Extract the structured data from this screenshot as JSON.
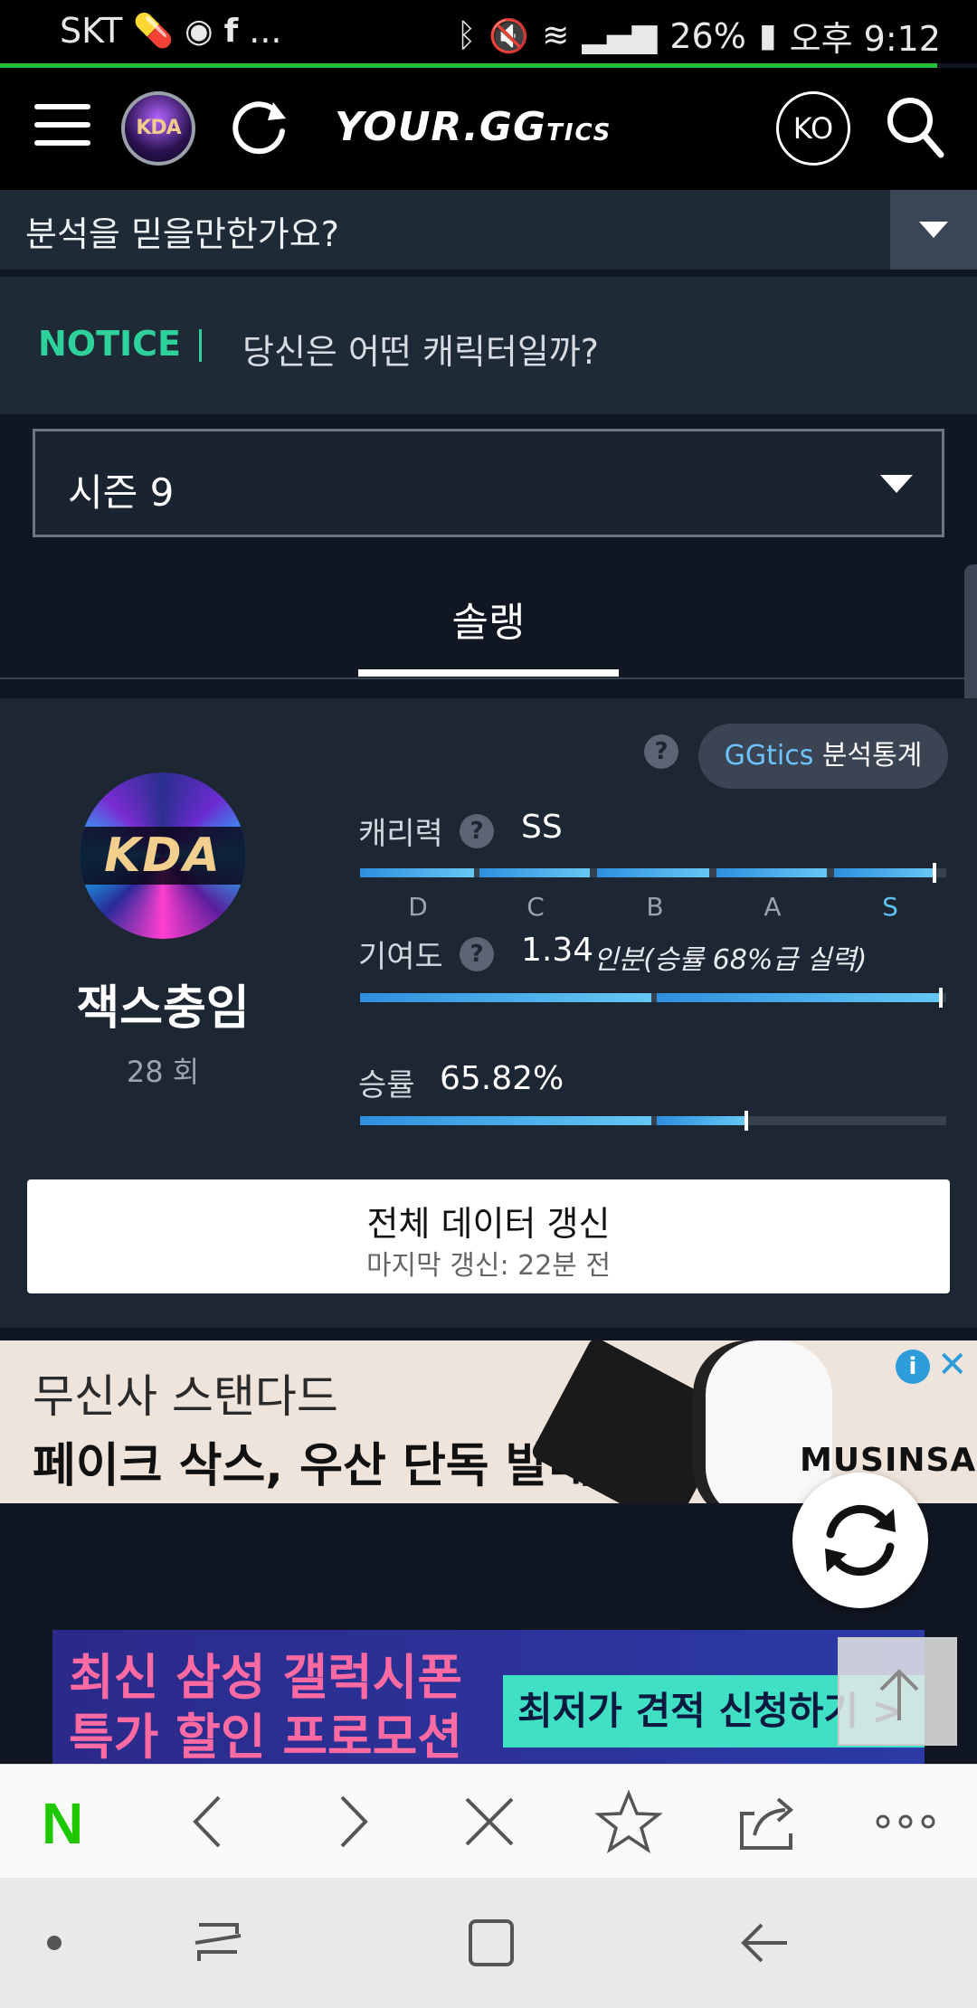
{
  "status_bar": {
    "carrier": "SKT",
    "more": "...",
    "battery": "26%",
    "time": "오후 9:12"
  },
  "header": {
    "logo_main": "YOUR.GG",
    "logo_suffix": "TICS",
    "avatar_text": "KDA",
    "lang": "KO"
  },
  "question_bar": {
    "text": "분석을 믿을만한가요?"
  },
  "notice": {
    "label": "NOTICE",
    "text": "당신은 어떤 캐릭터일까?"
  },
  "season_select": {
    "value": "시즌 9"
  },
  "tabs": [
    {
      "label": "솔랭",
      "active": true
    }
  ],
  "profile": {
    "avatar_text": "KDA",
    "name": "잭스충임",
    "games": "28 회",
    "stats_button_accent": "GGtics",
    "stats_button_label": " 분석통계",
    "help_glyph": "?",
    "skill": {
      "label": "캐리력",
      "value": "SS",
      "grades": [
        "D",
        "C",
        "B",
        "A",
        "S"
      ],
      "active_grade": "S",
      "level": 0.98
    },
    "contribution": {
      "label": "기여도",
      "value": "1.34",
      "sub": "인분(승률 68%급 실력)",
      "level": 0.99
    },
    "winrate": {
      "label": "승률",
      "value": "65.82%",
      "level": 0.6582
    },
    "refresh_button": {
      "label": "전체 데이터 갱신",
      "sub": "마지막 갱신: 22분 전"
    }
  },
  "ad1": {
    "line1": "무신사 스탠다드",
    "line2": "페이크 삭스, 우산 단독 발매",
    "brand": "MUSINSA",
    "info": "i",
    "close": "✕"
  },
  "ad2": {
    "line1": "최신 삼성 갤럭시폰",
    "line2": "특가 할인 프로모션",
    "cta": "최저가 견적 신청하기 >"
  },
  "browser": {
    "logo": "N"
  },
  "colors": {
    "notice_accent": "#2fd19b",
    "bar_gradient_start": "#2e8fde",
    "bar_gradient_end": "#67c7f4",
    "active_grade": "#5fc1f5",
    "load_bar": "#1fbf3a"
  }
}
